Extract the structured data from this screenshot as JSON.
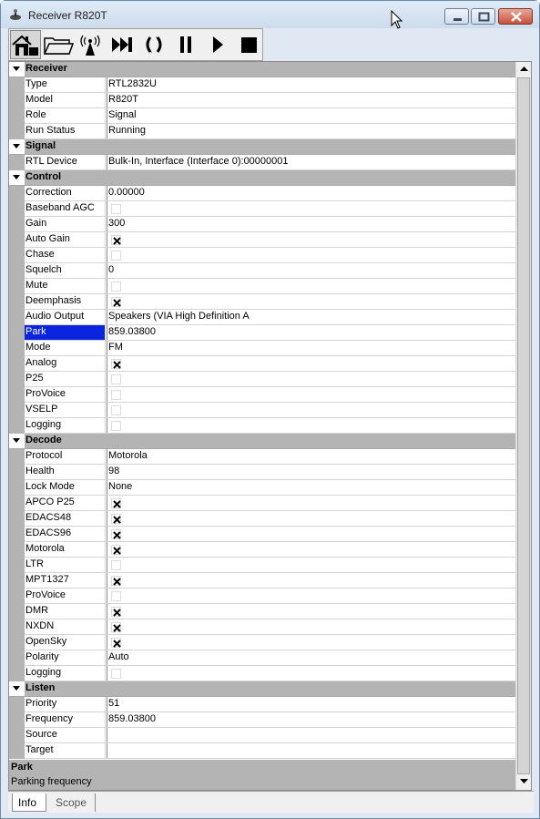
{
  "window": {
    "title": "Receiver R820T"
  },
  "toolbar": {
    "buttons": [
      {
        "name": "home-icon",
        "active": true
      },
      {
        "name": "folder-open-icon",
        "active": false
      },
      {
        "name": "antenna-icon",
        "active": false
      },
      {
        "name": "skip-forward-icon",
        "active": false
      },
      {
        "name": "refresh-icon",
        "active": false
      },
      {
        "name": "pause-icon",
        "active": false
      },
      {
        "name": "play-icon",
        "active": false
      },
      {
        "name": "stop-icon",
        "active": false
      }
    ]
  },
  "grid": {
    "categories": [
      {
        "label": "Receiver",
        "rows": [
          {
            "name": "Type",
            "value": "RTL2832U"
          },
          {
            "name": "Model",
            "value": "R820T"
          },
          {
            "name": "Role",
            "value": "Signal"
          },
          {
            "name": "Run Status",
            "value": "Running"
          }
        ]
      },
      {
        "label": "Signal",
        "rows": [
          {
            "name": "RTL Device",
            "value": "Bulk-In, Interface (Interface 0):00000001"
          }
        ]
      },
      {
        "label": "Control",
        "rows": [
          {
            "name": "Correction",
            "value": "0.00000"
          },
          {
            "name": "Baseband AGC",
            "checked": false
          },
          {
            "name": "Gain",
            "value": "300"
          },
          {
            "name": "Auto Gain",
            "checked": true
          },
          {
            "name": "Chase",
            "checked": false
          },
          {
            "name": "Squelch",
            "value": "0"
          },
          {
            "name": "Mute",
            "checked": false
          },
          {
            "name": "Deemphasis",
            "checked": true
          },
          {
            "name": "Audio Output",
            "value": "Speakers (VIA High Definition A"
          },
          {
            "name": "Park",
            "value": "859.03800",
            "selected": true
          },
          {
            "name": "Mode",
            "value": "FM"
          },
          {
            "name": "Analog",
            "checked": true
          },
          {
            "name": "P25",
            "checked": false
          },
          {
            "name": "ProVoice",
            "checked": false
          },
          {
            "name": "VSELP",
            "checked": false
          },
          {
            "name": "Logging",
            "checked": false
          }
        ]
      },
      {
        "label": "Decode",
        "rows": [
          {
            "name": "Protocol",
            "value": "Motorola"
          },
          {
            "name": "Health",
            "value": "98"
          },
          {
            "name": "Lock Mode",
            "value": "None"
          },
          {
            "name": "APCO P25",
            "checked": true
          },
          {
            "name": "EDACS48",
            "checked": true
          },
          {
            "name": "EDACS96",
            "checked": true
          },
          {
            "name": "Motorola",
            "checked": true
          },
          {
            "name": "LTR",
            "checked": false
          },
          {
            "name": "MPT1327",
            "checked": true
          },
          {
            "name": "ProVoice",
            "checked": false
          },
          {
            "name": "DMR",
            "checked": true
          },
          {
            "name": "NXDN",
            "checked": true
          },
          {
            "name": "OpenSky",
            "checked": true
          },
          {
            "name": "Polarity",
            "value": "Auto"
          },
          {
            "name": "Logging",
            "checked": false
          }
        ]
      },
      {
        "label": "Listen",
        "rows": [
          {
            "name": "Priority",
            "value": "51"
          },
          {
            "name": "Frequency",
            "value": "859.03800"
          },
          {
            "name": "Source",
            "value": ""
          },
          {
            "name": "Target",
            "value": ""
          }
        ]
      }
    ]
  },
  "description": {
    "title": "Park",
    "text": "Parking frequency"
  },
  "tabs": [
    {
      "label": "Info",
      "active": true
    },
    {
      "label": "Scope",
      "active": false
    }
  ]
}
